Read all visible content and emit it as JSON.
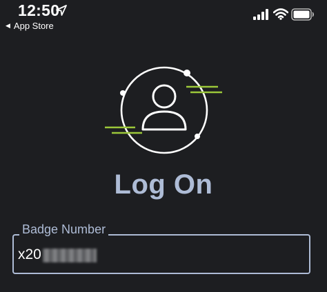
{
  "status_bar": {
    "time": "12:50",
    "back_label": "App Store",
    "icons": [
      "location-arrow-icon",
      "cellular-signal-icon",
      "wifi-icon",
      "battery-icon"
    ]
  },
  "logo": {
    "icon": "user-avatar-icon",
    "ring_color": "#ffffff",
    "accent_color": "#9cc83a"
  },
  "page": {
    "title": "Log On"
  },
  "form": {
    "badge_label": "Badge Number",
    "badge_value": "x20"
  },
  "colors": {
    "background": "#1d1e21",
    "title": "#aebcd6",
    "text": "#ffffff"
  }
}
